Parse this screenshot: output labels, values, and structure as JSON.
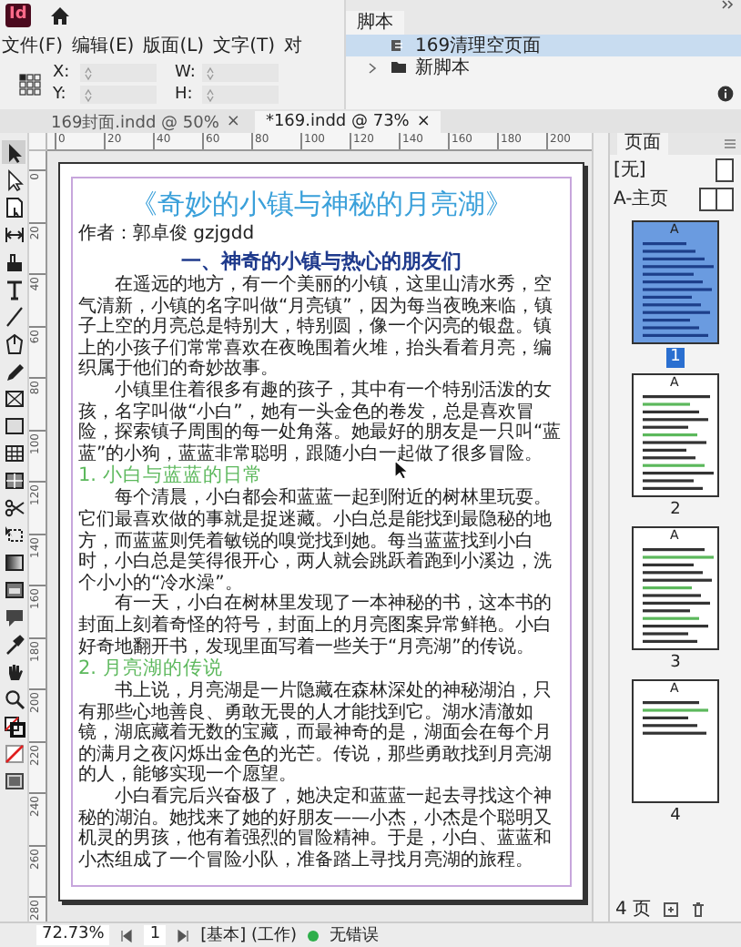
{
  "app": {
    "logo": "Id"
  },
  "menu": [
    {
      "label": "文件(F)"
    },
    {
      "label": "编辑(E)"
    },
    {
      "label": "版面(L)"
    },
    {
      "label": "文字(T)"
    },
    {
      "label": "对"
    }
  ],
  "control_panel": {
    "fields": [
      {
        "label": "X:"
      },
      {
        "label": "Y:"
      },
      {
        "label": "W:"
      },
      {
        "label": "H:"
      }
    ]
  },
  "scripts_panel": {
    "tab": "脚本",
    "items": [
      {
        "label": "169清理空页面",
        "kind": "script",
        "selected": true
      },
      {
        "label": "新脚本",
        "kind": "folder",
        "selected": false
      }
    ]
  },
  "document_tabs": [
    {
      "label": "169封面.indd @ 50%",
      "close": "×",
      "selected": false
    },
    {
      "label": "*169.indd @ 73%",
      "close": "×",
      "selected": true
    }
  ],
  "tools": [
    {
      "kind": "select",
      "selected": true
    },
    {
      "kind": "direct",
      "selected": false
    },
    {
      "kind": "page",
      "selected": false
    },
    {
      "kind": "gap",
      "selected": false
    },
    {
      "kind": "content",
      "selected": false
    },
    {
      "kind": "type",
      "selected": false
    },
    {
      "kind": "line",
      "selected": false
    },
    {
      "kind": "pen",
      "selected": false
    },
    {
      "kind": "pencil",
      "selected": false
    },
    {
      "kind": "frame",
      "selected": false
    },
    {
      "kind": "rect",
      "selected": false
    },
    {
      "kind": "table",
      "selected": false
    },
    {
      "kind": "grid",
      "selected": false
    },
    {
      "kind": "scissors",
      "selected": false
    },
    {
      "kind": "transform",
      "selected": false
    },
    {
      "kind": "gradient",
      "selected": false
    },
    {
      "kind": "feather",
      "selected": false
    },
    {
      "kind": "note",
      "selected": false
    },
    {
      "kind": "eyedropper",
      "selected": false
    },
    {
      "kind": "hand",
      "selected": false
    },
    {
      "kind": "zoom",
      "selected": false
    },
    {
      "kind": "colors",
      "selected": false
    },
    {
      "kind": "none",
      "selected": false
    },
    {
      "kind": "mode",
      "selected": false
    }
  ],
  "rulers": {
    "horizontal": [
      "0",
      "20",
      "40",
      "60",
      "80",
      "100",
      "120",
      "140",
      "160",
      "180",
      "200"
    ],
    "vertical": [
      "0",
      "20",
      "40",
      "60",
      "80",
      "100",
      "120",
      "140",
      "160",
      "180",
      "200",
      "220",
      "240",
      "260",
      "280"
    ]
  },
  "document": {
    "title": "《奇妙的小镇与神秘的月亮湖》",
    "blocks": [
      {
        "kind": "author",
        "text": "作者：郭卓俊 gzjgdd"
      },
      {
        "kind": "heading",
        "text": "一、神奇的小镇与热心的朋友们"
      },
      {
        "kind": "paragraph",
        "text": "在遥远的地方，有一个美丽的小镇，这里山清水秀，空气清新，小镇的名字叫做“月亮镇”，因为每当夜晚来临，镇子上空的月亮总是特别大，特别圆，像一个闪亮的银盘。镇上的小孩子们常常喜欢在夜晚围着火堆，抬头看着月亮，编织属于他们的奇妙故事。"
      },
      {
        "kind": "paragraph",
        "text": "小镇里住着很多有趣的孩子，其中有一个特别活泼的女孩，名字叫做“小白”，她有一头金色的卷发，总是喜欢冒险，探索镇子周围的每一处角落。她最好的朋友是一只叫“蓝蓝”的小狗，蓝蓝非常聪明，跟随小白一起做了很多冒险。"
      },
      {
        "kind": "subheading",
        "text": "1.  小白与蓝蓝的日常"
      },
      {
        "kind": "paragraph",
        "text": "每个清晨，小白都会和蓝蓝一起到附近的树林里玩耍。它们最喜欢做的事就是捉迷藏。小白总是能找到最隐秘的地方，而蓝蓝则凭着敏锐的嗅觉找到她。每当蓝蓝找到小白时，小白总是笑得很开心，两人就会跳跃着跑到小溪边，洗个小小的“冷水澡”。"
      },
      {
        "kind": "paragraph",
        "text": "有一天，小白在树林里发现了一本神秘的书，这本书的封面上刻着奇怪的符号，封面上的月亮图案异常鲜艳。小白好奇地翻开书，发现里面写着一些关于“月亮湖”的传说。"
      },
      {
        "kind": "subheading",
        "text": "2.  月亮湖的传说"
      },
      {
        "kind": "paragraph",
        "text": "书上说，月亮湖是一片隐藏在森林深处的神秘湖泊，只有那些心地善良、勇敢无畏的人才能找到它。湖水清澈如镜，湖底藏着无数的宝藏，而最神奇的是，湖面会在每个月的满月之夜闪烁出金色的光芒。传说，那些勇敢找到月亮湖的人，能够实现一个愿望。"
      },
      {
        "kind": "paragraph",
        "text": "小白看完后兴奋极了，她决定和蓝蓝一起去寻找这个神秘的湖泊。她找来了她的好朋友——小杰，小杰是个聪明又机灵的男孩，他有着强烈的冒险精神。于是，小白、蓝蓝和小杰组成了一个冒险小队，准备踏上寻找月亮湖的旅程。"
      }
    ]
  },
  "pages_panel": {
    "tab": "页面",
    "masters": [
      {
        "label": "[无]",
        "kind": "single"
      },
      {
        "label": "A-主页",
        "kind": "spread"
      }
    ],
    "pages": [
      {
        "number": "1",
        "master": "A",
        "selected": true
      },
      {
        "number": "2",
        "master": "A",
        "selected": false
      },
      {
        "number": "3",
        "master": "A",
        "selected": false
      },
      {
        "number": "4",
        "master": "A",
        "selected": false
      }
    ],
    "summary": "4 页"
  },
  "status_bar": {
    "zoom": "72.73%",
    "page": "1",
    "style": "[基本] (工作)",
    "preflight": "无错误",
    "preflight_ok": true
  }
}
